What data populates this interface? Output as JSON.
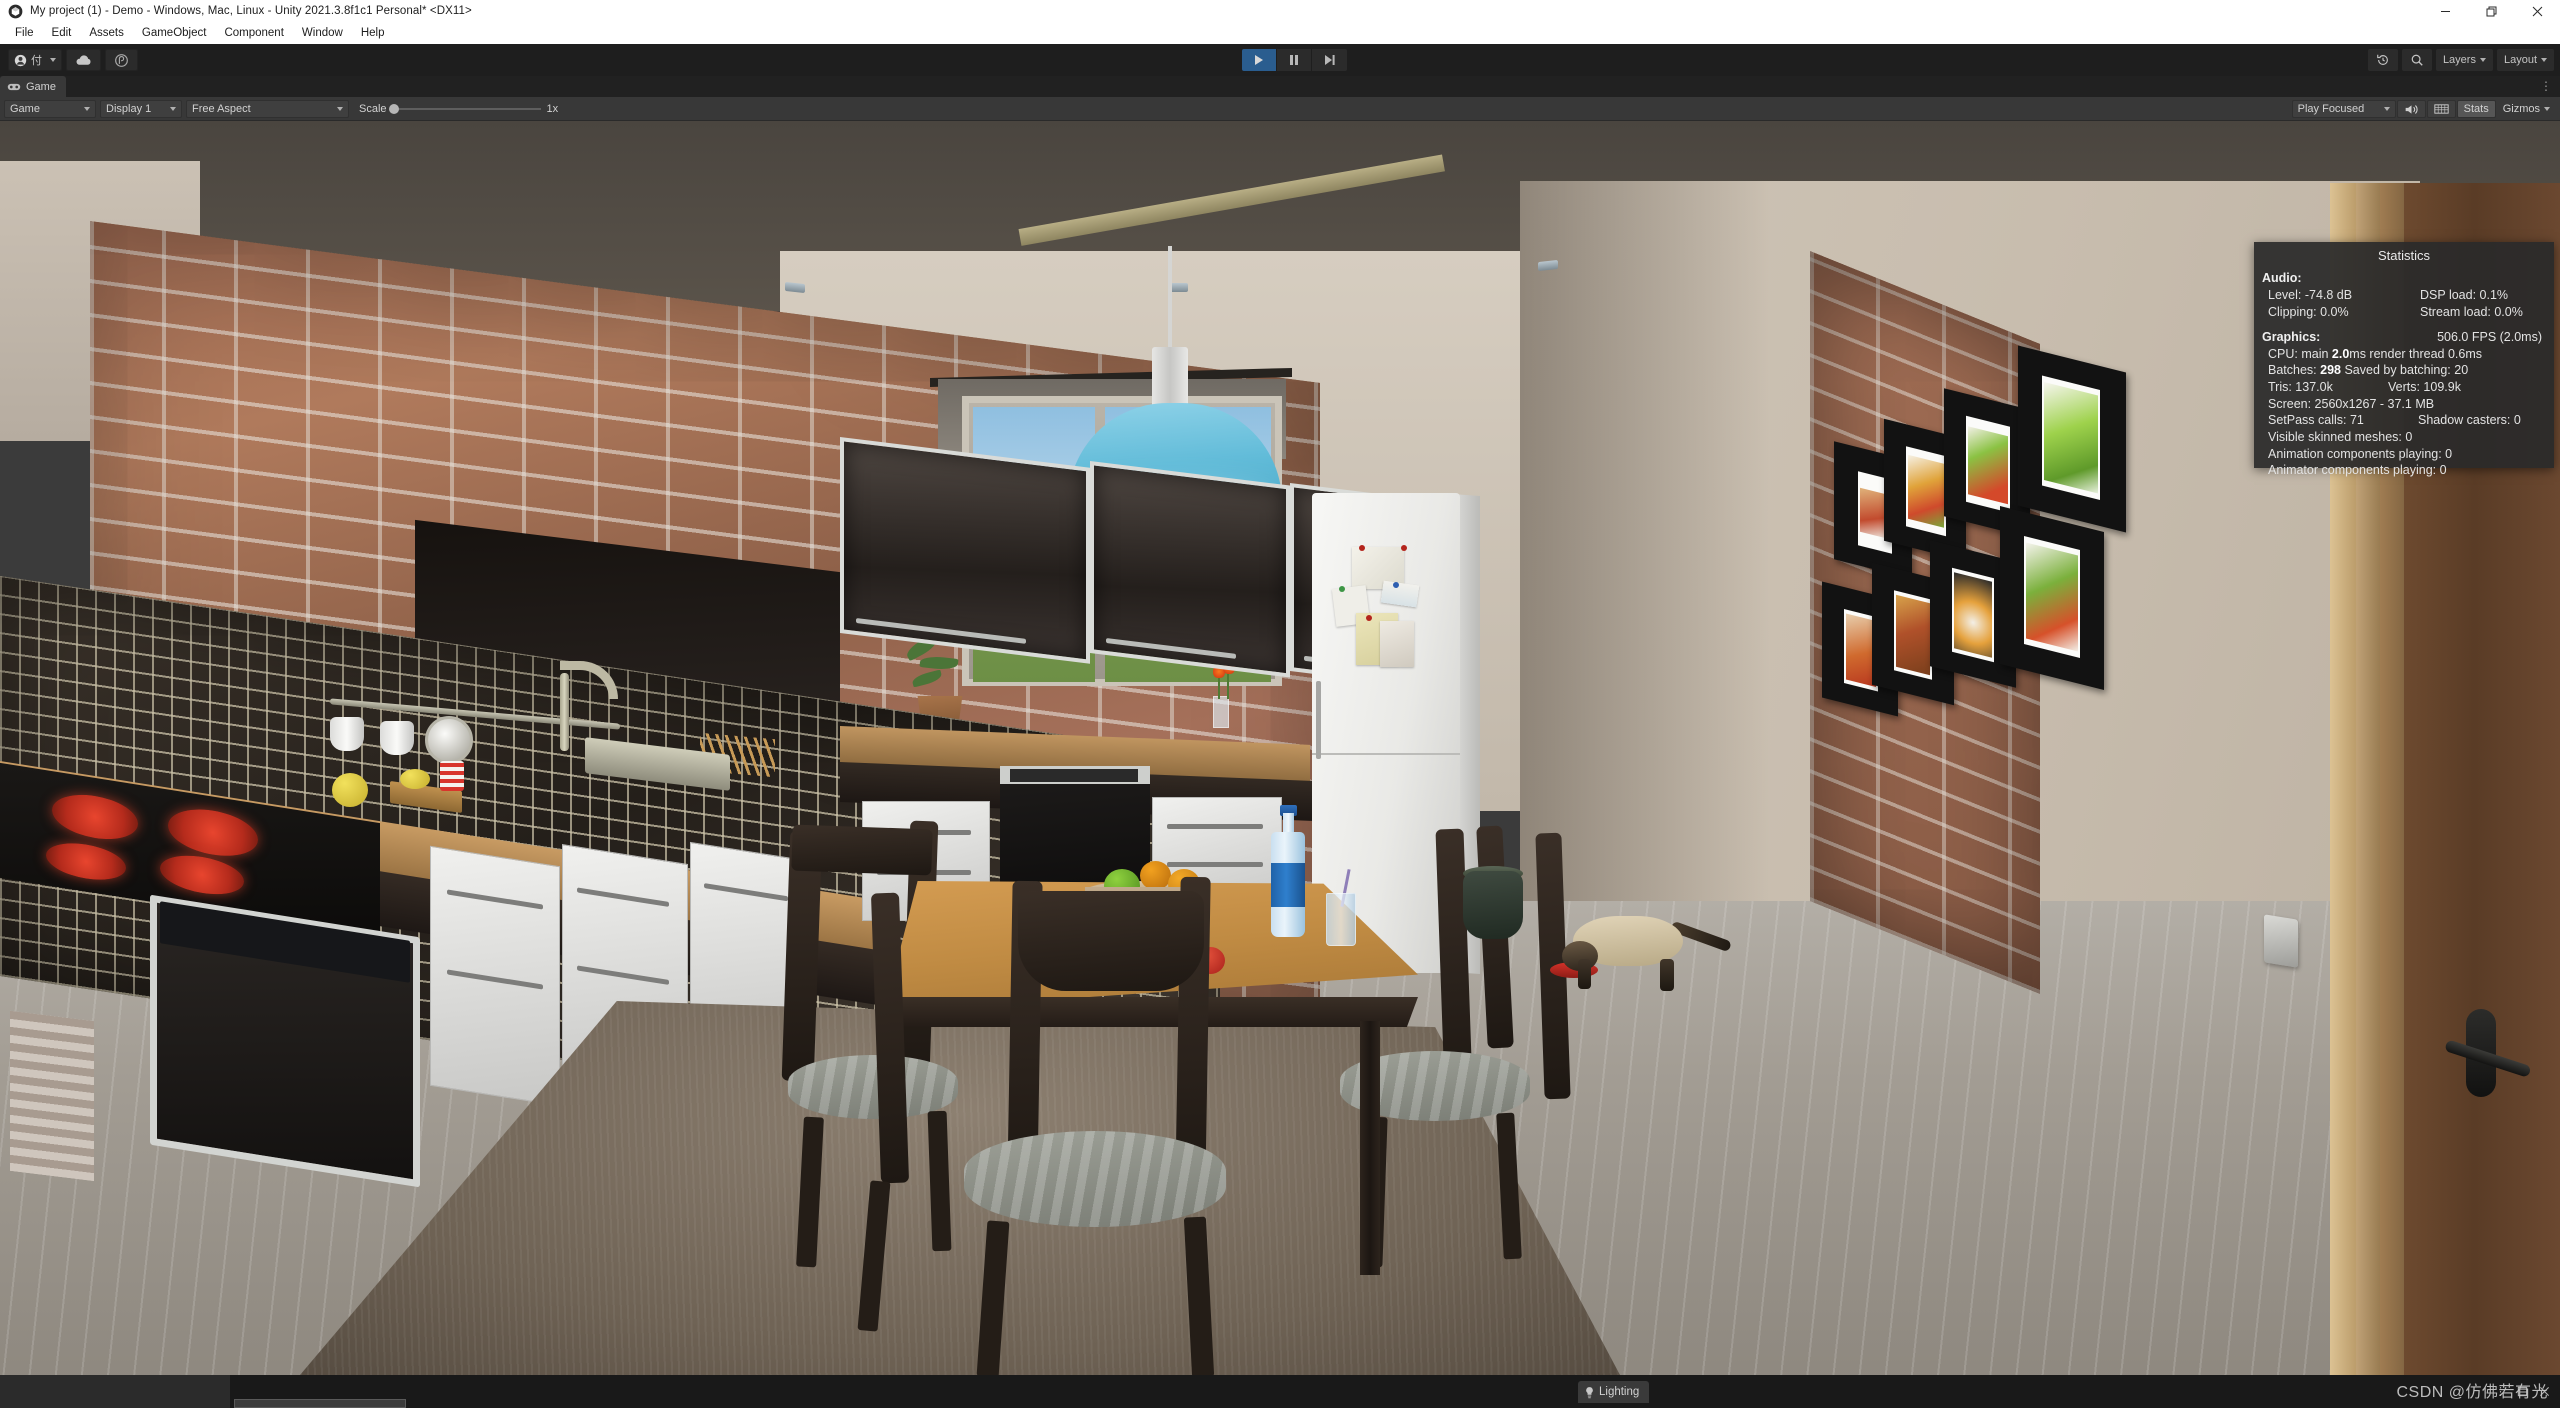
{
  "window": {
    "title": "My project (1) - Demo - Windows, Mac, Linux - Unity 2021.3.8f1c1 Personal* <DX11>",
    "app_icon": "unity-logo-icon",
    "minimize": "minimize-icon",
    "maximize": "restore-icon",
    "close": "close-icon"
  },
  "menubar": {
    "items": [
      {
        "label": "File"
      },
      {
        "label": "Edit"
      },
      {
        "label": "Assets"
      },
      {
        "label": "GameObject"
      },
      {
        "label": "Component"
      },
      {
        "label": "Window"
      },
      {
        "label": "Help"
      }
    ]
  },
  "toolbar": {
    "account_label": "付",
    "cloud_icon": "cloud-icon",
    "collab_icon": "collab-icon",
    "play_icon": "play-icon",
    "pause_icon": "pause-icon",
    "step_icon": "step-icon",
    "play_active": true,
    "undo_history_icon": "undo-history-icon",
    "search_icon": "search-icon",
    "layers_label": "Layers",
    "layout_label": "Layout"
  },
  "game_tab": {
    "label": "Game",
    "icon": "gamepad-icon",
    "kebab": "⋮"
  },
  "game_toolbar": {
    "view_mode": "Game",
    "display": "Display 1",
    "aspect": "Free Aspect",
    "scale_label": "Scale",
    "scale_value": "1x",
    "play_mode": "Play Focused",
    "mute_icon": "audio-mute-icon",
    "stats_toggle_icon": "frame-debug-icon",
    "stats_label": "Stats",
    "gizmos_label": "Gizmos"
  },
  "statistics": {
    "title": "Statistics",
    "audio_heading": "Audio:",
    "audio": [
      {
        "left": "Level: -74.8 dB",
        "right": "DSP load: 0.1%"
      },
      {
        "left": "Clipping: 0.0%",
        "right": "Stream load: 0.0%"
      }
    ],
    "graphics_heading": "Graphics:",
    "fps": "506.0 FPS (2.0ms)",
    "cpu_prefix": "CPU: main ",
    "cpu_bold": "2.0",
    "cpu_suffix": "ms  render thread 0.6ms",
    "batches_prefix": "Batches: ",
    "batches_bold": "298",
    "batches_suffix": "    Saved by batching: 20",
    "tris": "Tris: 137.0k",
    "verts": "Verts: 109.9k",
    "screen": "Screen: 2560x1267 - 37.1 MB",
    "setpass": "SetPass calls: 71",
    "shadow_casters": "Shadow casters: 0",
    "skinned_meshes": "Visible skinned meshes: 0",
    "anim_components": "Animation components playing: 0",
    "animator_components": "Animator components playing: 0"
  },
  "status_bar": {
    "lighting_tab": "Lighting",
    "lighting_icon": "lightbulb-icon",
    "kebab": "⋮",
    "maximize_icon": "maximize-panel-icon",
    "close_icon": "close-panel-icon",
    "watermark": "CSDN @仿佛若有光"
  },
  "scene": {
    "description": "Unity game view rendering a 3D kitchen and dining room interior",
    "colors": {
      "lamp_shade": "#62bcd9",
      "brick_wall": "#a5705a",
      "counter_wood": "#c89b63",
      "table_wood": "#c08b43",
      "wall_paint": "#c8bdae",
      "floor": "#a39d94",
      "rug": "#6e6254",
      "bottle_label": "#2f7fcd",
      "cat_bowl": "#d6332a",
      "tomato": "#c73826",
      "burner": "#b52b1c"
    },
    "objects": [
      {
        "name": "pendant-lamp"
      },
      {
        "name": "brick-wall"
      },
      {
        "name": "upper-cabinets"
      },
      {
        "name": "range-hood"
      },
      {
        "name": "mosaic-backsplash"
      },
      {
        "name": "cooktop"
      },
      {
        "name": "oven"
      },
      {
        "name": "sink-faucet"
      },
      {
        "name": "dishwasher"
      },
      {
        "name": "refrigerator"
      },
      {
        "name": "window"
      },
      {
        "name": "dining-table"
      },
      {
        "name": "dining-chairs"
      },
      {
        "name": "fruit-bowl"
      },
      {
        "name": "water-bottle"
      },
      {
        "name": "drinking-glass"
      },
      {
        "name": "tomato"
      },
      {
        "name": "siamese-cat"
      },
      {
        "name": "cat-food-bowl"
      },
      {
        "name": "picture-frames"
      },
      {
        "name": "area-rug"
      },
      {
        "name": "wooden-door"
      },
      {
        "name": "light-switch"
      },
      {
        "name": "potted-plant"
      }
    ]
  }
}
